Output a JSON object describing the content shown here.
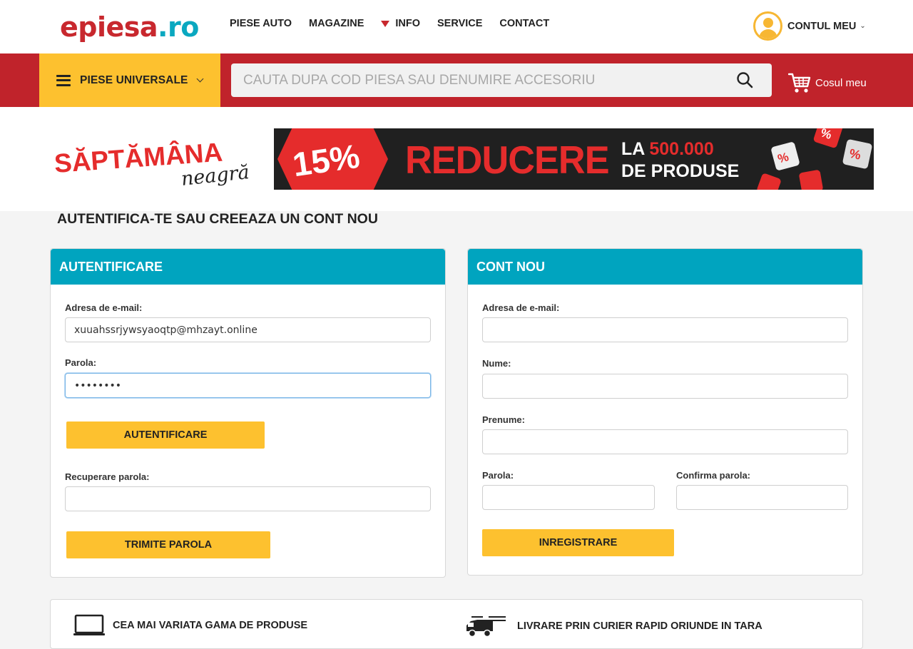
{
  "logo": {
    "e": "e",
    "piesa": "piesa",
    "dot": ".",
    "ro": "ro"
  },
  "topnav": {
    "items": [
      {
        "label": "PIESE AUTO"
      },
      {
        "label": "MAGAZINE"
      },
      {
        "label": "INFO"
      },
      {
        "label": "SERVICE"
      },
      {
        "label": "CONTACT"
      }
    ]
  },
  "account": {
    "label": "CONTUL MEU"
  },
  "redbar": {
    "category_label": "PIESE UNIVERSALE",
    "search_placeholder": "CAUTA DUPA COD PIESA SAU DENUMIRE ACCESORIU",
    "cart_label": "Cosul meu"
  },
  "banner": {
    "title_line1": "SĂPTĂMÂNA",
    "title_line2": "neagră",
    "percent": "15%",
    "reducere": "REDUCERE",
    "la": "LA",
    "la_number": "500.000",
    "de_produse": "DE PRODUSE"
  },
  "page_title": "AUTENTIFICA-TE SAU CREEAZA UN CONT NOU",
  "login": {
    "heading": "AUTENTIFICARE",
    "email_label": "Adresa de e-mail:",
    "email_value": "xuuahssrjywsyaoqtp@mhzayt.online",
    "password_label": "Parola:",
    "password_value": "••••••••",
    "submit_label": "AUTENTIFICARE",
    "recover_label": "Recuperare parola:",
    "recover_value": "",
    "recover_button": "TRIMITE PAROLA"
  },
  "register": {
    "heading": "CONT NOU",
    "email_label": "Adresa de e-mail:",
    "name_label": "Nume:",
    "surname_label": "Prenume:",
    "password_label": "Parola:",
    "confirm_label": "Confirma parola:",
    "submit_label": "INREGISTRARE"
  },
  "features": [
    {
      "label": "CEA MAI VARIATA GAMA DE PRODUSE",
      "icon": "laptop-icon"
    },
    {
      "label": "LIVRARE PRIN CURIER RAPID ORIUNDE IN TARA",
      "icon": "delivery-truck-icon"
    }
  ],
  "colors": {
    "brand_red": "#c0232b",
    "accent_yellow": "#fdc12f",
    "panel_teal": "#00a4bf",
    "logo_blue": "#0aa8c0"
  }
}
